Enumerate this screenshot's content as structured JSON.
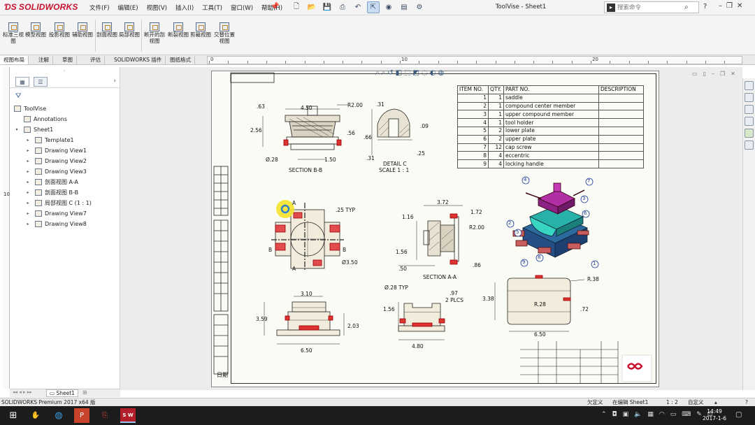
{
  "app": {
    "brand": "SOLIDWORKS",
    "window_title": "ToolVise - Sheet1"
  },
  "menu": [
    "文件(F)",
    "编辑(E)",
    "视图(V)",
    "插入(I)",
    "工具(T)",
    "窗口(W)",
    "帮助(H)"
  ],
  "search": {
    "placeholder": "搜索命令"
  },
  "command_manager": [
    {
      "label": "标准三视图",
      "icon": "standard-3-view-icon"
    },
    {
      "label": "模型视图",
      "icon": "model-view-icon"
    },
    {
      "label": "投影视图",
      "icon": "projected-view-icon"
    },
    {
      "label": "辅助视图",
      "icon": "auxiliary-view-icon"
    },
    {
      "label": "剖面视图",
      "icon": "section-view-icon"
    },
    {
      "label": "局部视图",
      "icon": "detail-view-icon"
    },
    {
      "label": "断开的剖视图",
      "icon": "broken-out-section-icon"
    },
    {
      "label": "断裂视图",
      "icon": "break-view-icon"
    },
    {
      "label": "剪裁视图",
      "icon": "crop-view-icon"
    },
    {
      "label": "交替位置视图",
      "icon": "alternate-position-view-icon"
    }
  ],
  "tabs": [
    "视图布局",
    "注解",
    "草图",
    "评估",
    "SOLIDWORKS 插件",
    "图纸格式"
  ],
  "ruler": {
    "top_labels": [
      "0",
      "10",
      "20"
    ],
    "left_label": "10"
  },
  "feature_tree": {
    "root": "ToolVise",
    "items": [
      {
        "label": "Annotations",
        "level": 1,
        "expandable": false
      },
      {
        "label": "Sheet1",
        "level": 1,
        "expandable": true,
        "expanded": true
      },
      {
        "label": "Template1",
        "level": 2,
        "expandable": true
      },
      {
        "label": "Drawing View1",
        "level": 2,
        "expandable": true
      },
      {
        "label": "Drawing View2",
        "level": 2,
        "expandable": true
      },
      {
        "label": "Drawing View3",
        "level": 2,
        "expandable": true
      },
      {
        "label": "剖面视图 A-A",
        "level": 2,
        "expandable": true
      },
      {
        "label": "剖面视图 B-B",
        "level": 2,
        "expandable": true
      },
      {
        "label": "局部视图 C (1 : 1)",
        "level": 2,
        "expandable": true
      },
      {
        "label": "Drawing View7",
        "level": 2,
        "expandable": true
      },
      {
        "label": "Drawing View8",
        "level": 2,
        "expandable": true
      }
    ]
  },
  "sheet_tab": "Sheet1",
  "bom": {
    "headers": [
      "ITEM NO.",
      "QTY.",
      "PART NO.",
      "DESCRIPTION"
    ],
    "rows": [
      [
        "1",
        "1",
        "saddle",
        ""
      ],
      [
        "2",
        "1",
        "compound center member",
        ""
      ],
      [
        "3",
        "1",
        "upper compound member",
        ""
      ],
      [
        "4",
        "1",
        "tool holder",
        ""
      ],
      [
        "5",
        "2",
        "lower plate",
        ""
      ],
      [
        "6",
        "2",
        "upper plate",
        ""
      ],
      [
        "7",
        "12",
        "cap screw",
        ""
      ],
      [
        "8",
        "4",
        "eccentric",
        ""
      ],
      [
        "9",
        "4",
        "locking handle",
        ""
      ]
    ]
  },
  "drawing_labels": {
    "section_bb": "SECTION B-B",
    "detail_c": "DETAIL C",
    "detail_scale": "SCALE 1 : 1",
    "section_aa": "SECTION A-A",
    "dims_bb": [
      ".63",
      "4.50",
      "R2.00",
      "2.56",
      ".56",
      "Ø.28",
      "1.50"
    ],
    "dims_c": [
      ".31",
      ".66",
      ".09",
      ".31",
      ".25"
    ],
    "dims_top": [
      "A",
      ".25 TYP",
      "B",
      "B",
      "A",
      "Ø3.50"
    ],
    "dims_aa": [
      "3.72",
      "1.72",
      "1.16",
      "R2.00",
      "1.56",
      ".50",
      ".86"
    ],
    "dims_front": [
      "3.10",
      "3.59",
      "2.03",
      "6.50"
    ],
    "dims_mid": [
      "Ø.28 TYP",
      ".97",
      "2 PLCS",
      "1.56",
      "4.80"
    ],
    "dims_right": [
      "3.38",
      "R.38",
      "R.28",
      ".72",
      "6.50"
    ],
    "balloons": [
      "4",
      "7",
      "3",
      "6",
      "5",
      "2",
      "9",
      "8",
      "1"
    ]
  },
  "title_block": {
    "left_label": "日期"
  },
  "status": {
    "product": "SOLIDWORKS Premium 2017 x64 版",
    "defined": "欠定义",
    "editing": "在编辑 Sheet1",
    "scale": "1 : 2",
    "custom": "自定义"
  },
  "taskbar": {
    "time": "14:49",
    "date": "2017-1-6",
    "sw_badge": "S W"
  },
  "colors": {
    "brand_red": "#c8102e",
    "balloon_blue": "#1f3e9a",
    "cursor_yellow": "#f4e22a",
    "model_purple": "#a32a9a",
    "model_teal": "#1fa6a0",
    "model_blue": "#2c4e8c"
  }
}
